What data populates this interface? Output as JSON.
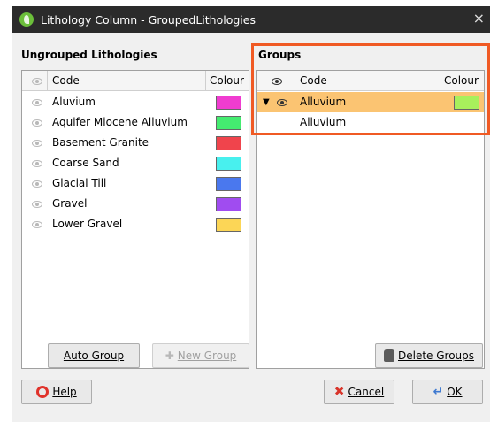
{
  "window": {
    "title": "Lithology Column - GroupedLithologies",
    "close": "×"
  },
  "ungrouped": {
    "title": "Ungrouped Lithologies",
    "headers": {
      "code": "Code",
      "colour": "Colour"
    },
    "rows": [
      {
        "code": "Aluvium",
        "colour": "#f03cd0"
      },
      {
        "code": "Aquifer Miocene Alluvium",
        "colour": "#44ec70"
      },
      {
        "code": "Basement Granite",
        "colour": "#f0444c"
      },
      {
        "code": "Coarse Sand",
        "colour": "#48f0ee"
      },
      {
        "code": "Glacial Till",
        "colour": "#4a78ee"
      },
      {
        "code": "Gravel",
        "colour": "#a04cf0"
      },
      {
        "code": "Lower Gravel",
        "colour": "#fcd656"
      }
    ]
  },
  "groups": {
    "title": "Groups",
    "headers": {
      "code": "Code",
      "colour": "Colour"
    },
    "group_row": {
      "arrow": "▼",
      "code": "Alluvium",
      "colour": "#a8f05c"
    },
    "child_row": {
      "code": "Alluvium"
    },
    "highlight_color": "#f05a24",
    "selection_color": "#fbc472"
  },
  "buttons": {
    "auto_group": "Auto Group",
    "new_group": "New Group",
    "delete_groups": "Delete Groups",
    "help": "Help",
    "cancel": "Cancel",
    "ok": "OK"
  }
}
